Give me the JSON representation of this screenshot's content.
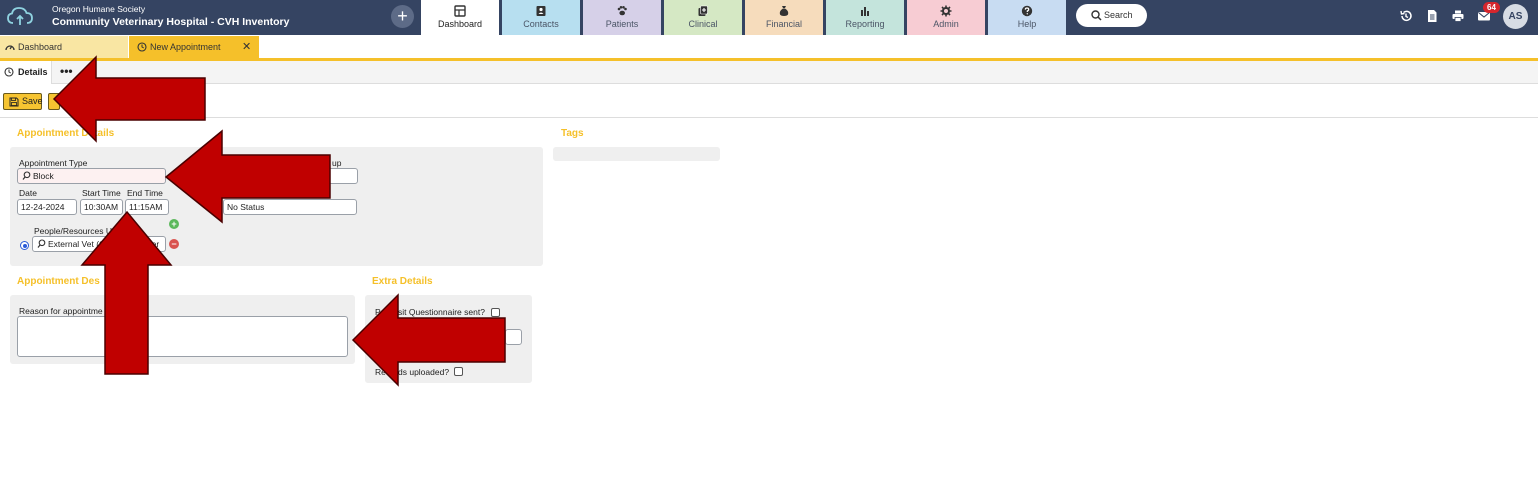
{
  "header": {
    "org_name": "Oregon Humane Society",
    "site_name": "Community Veterinary Hospital - CVH Inventory",
    "add_label": "+",
    "search_label": "Search",
    "notification_count": "64",
    "avatar_initials": "AS"
  },
  "nav": [
    {
      "label": "Dashboard",
      "icon": "dashboard-icon",
      "color": "#ffffff"
    },
    {
      "label": "Contacts",
      "icon": "contacts-icon",
      "color": "#b7dff0"
    },
    {
      "label": "Patients",
      "icon": "paw-icon",
      "color": "#d6d0e8"
    },
    {
      "label": "Clinical",
      "icon": "clinical-icon",
      "color": "#d5e8c4"
    },
    {
      "label": "Financial",
      "icon": "money-bag-icon",
      "color": "#f6dcbc"
    },
    {
      "label": "Reporting",
      "icon": "bar-chart-icon",
      "color": "#c4e4dc"
    },
    {
      "label": "Admin",
      "icon": "gear-icon",
      "color": "#f7ccd3"
    },
    {
      "label": "Help",
      "icon": "help-icon",
      "color": "#c8dcf2"
    }
  ],
  "doc_tabs": {
    "dashboard": "Dashboard",
    "new_appointment": "New Appointment",
    "close": "✕"
  },
  "subtabs": {
    "details": "Details",
    "more": "•••"
  },
  "toolbar": {
    "save_label": "Save"
  },
  "appointment_details": {
    "title": "Appointment Details",
    "type_label": "Appointment Type",
    "type_value": "Block",
    "group_label": "up",
    "date_label": "Date",
    "date_value": "12-24-2024",
    "start_label": "Start Time",
    "start_value": "10:30AM",
    "end_label": "End Time",
    "end_value": "11:15AM",
    "status_value": "No Status",
    "people_label": "People/Resources Us",
    "people_value": "External Vet (C",
    "people_value_tail": "ster"
  },
  "tags": {
    "title": "Tags"
  },
  "description": {
    "title": "Appointment Des",
    "reason_label": "Reason for appointme"
  },
  "extra": {
    "title": "Extra Details",
    "questionnaire_label_a": "P",
    "questionnaire_label_b": "sit Questionnaire sent?",
    "records_label_a": "Re",
    "records_label_b": "ds uploaded?"
  },
  "colors": {
    "topbar": "#354462",
    "accent": "#f5c02a",
    "arrow_fill": "#c00000",
    "arrow_stroke": "#4a0000"
  }
}
